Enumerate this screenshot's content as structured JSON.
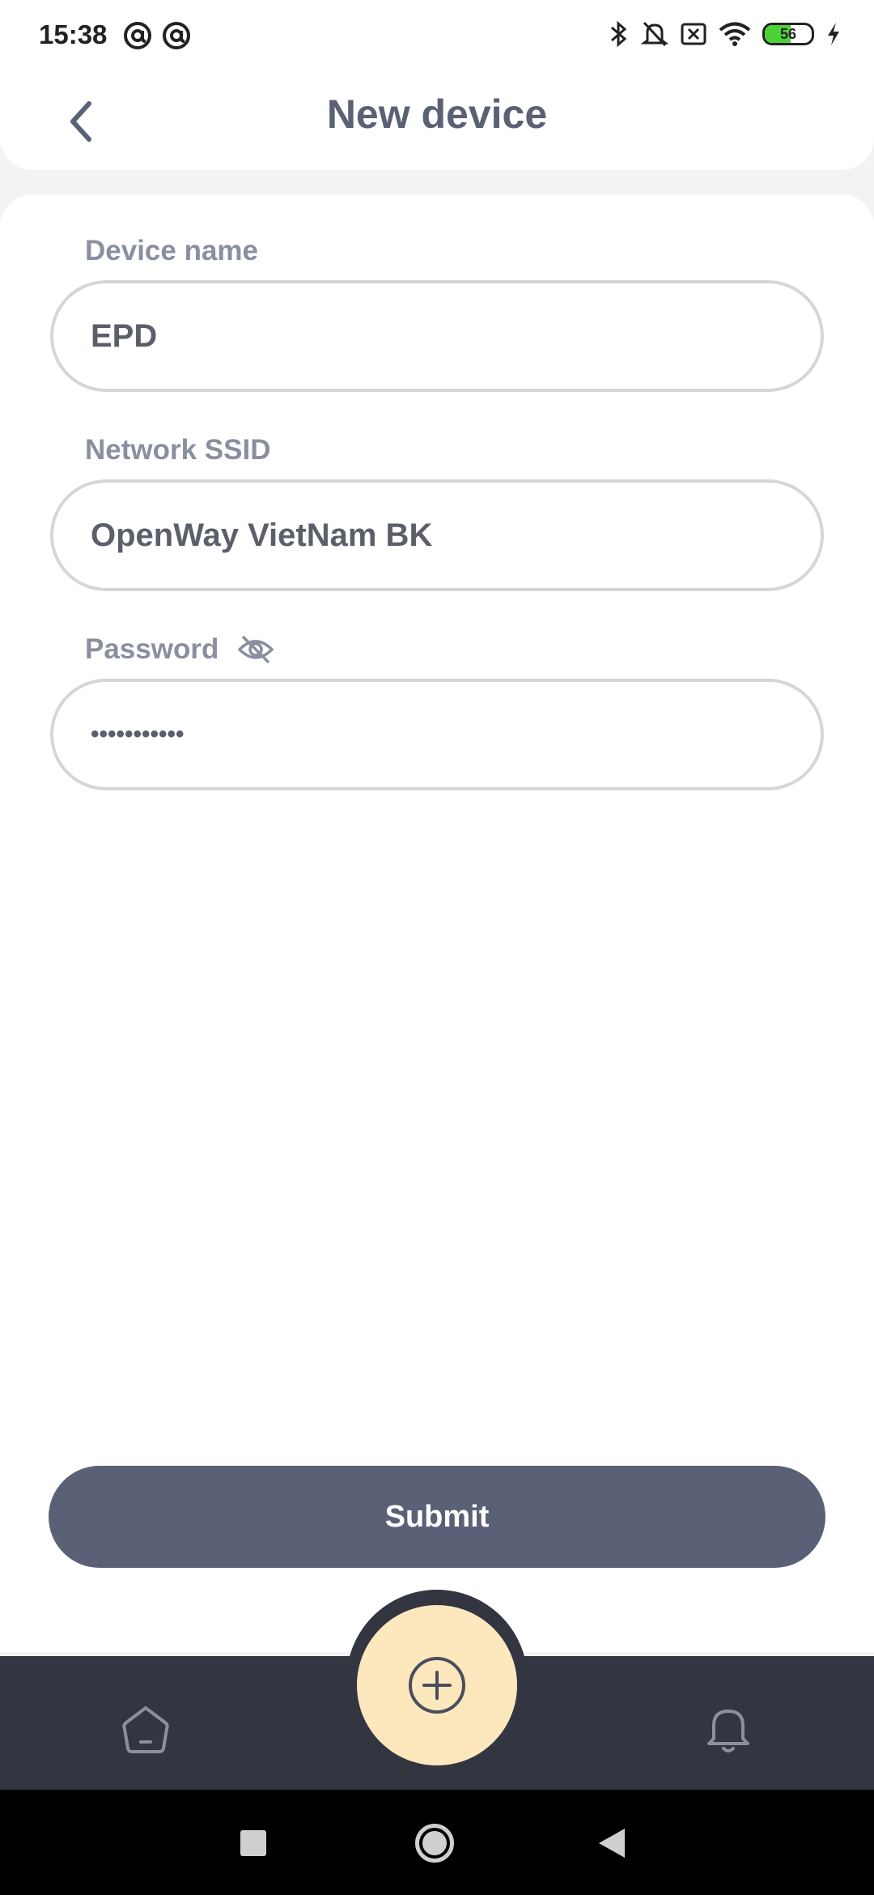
{
  "status_bar": {
    "time": "15:38",
    "left_icons": [
      "at-sign-icon",
      "at-sign-icon"
    ],
    "right_icons": [
      "bluetooth-icon",
      "bell-muted-icon",
      "no-sim-icon",
      "wifi-icon"
    ],
    "battery_level": "56",
    "battery_fill_fraction": 0.56,
    "charging": true
  },
  "header": {
    "title": "New device",
    "back_icon": "chevron-left-icon"
  },
  "form": {
    "device_name": {
      "label": "Device name",
      "value": "EPD"
    },
    "network_ssid": {
      "label": "Network SSID",
      "value": "OpenWay VietNam BK"
    },
    "password": {
      "label": "Password",
      "value": "•••••••••••",
      "toggle_icon": "eye-off-icon"
    }
  },
  "submit": {
    "label": "Submit"
  },
  "bottom_nav": {
    "items": [
      "home-icon",
      "add-circle-icon",
      "bell-icon"
    ]
  },
  "colors": {
    "title": "#5a6175",
    "label": "#8a8f9f",
    "input_border": "#d6d6d6",
    "submit_bg": "#5a6075",
    "nav_bg": "#333641",
    "fab_bg": "#fde8be"
  }
}
